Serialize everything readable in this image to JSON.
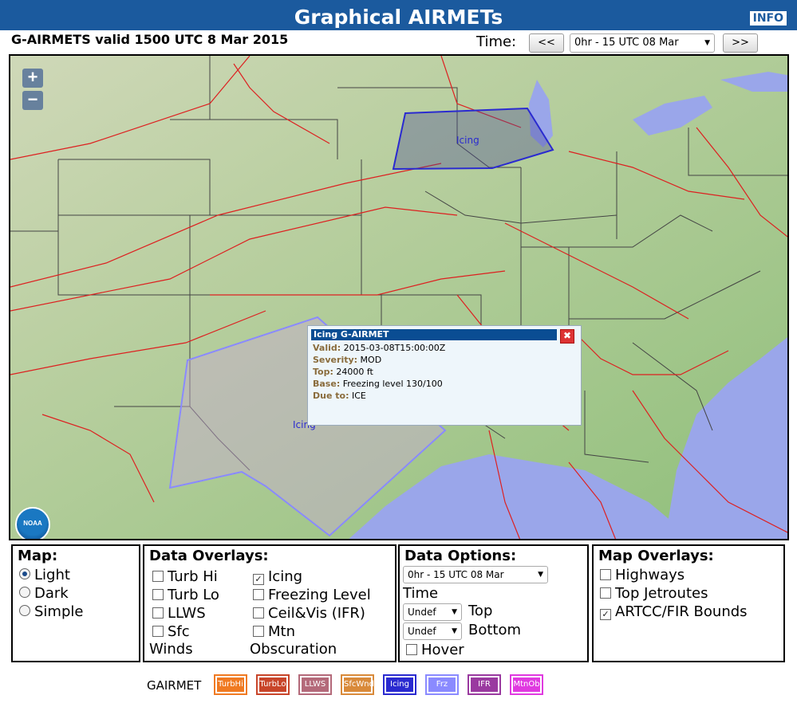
{
  "header": {
    "title": "Graphical AIRMETs",
    "info_label": "INFO"
  },
  "valid_text": "G-AIRMETS valid 1500 UTC 8 Mar 2015",
  "time": {
    "label": "Time:",
    "prev_label": "<<",
    "next_label": ">>",
    "selected": "0hr - 15 UTC 08 Mar"
  },
  "map": {
    "zoom_in": "+",
    "zoom_out": "−",
    "noaa_logo": "NOAA",
    "areas": [
      {
        "label": "Icing",
        "color": "#2a2ad0"
      },
      {
        "label": "Icing",
        "color": "#8a8aff"
      }
    ]
  },
  "popup": {
    "title": "Icing G-AIRMET",
    "close_icon": "close-icon",
    "rows": [
      {
        "key": "Valid:",
        "value": "2015-03-08T15:00:00Z"
      },
      {
        "key": "Severity:",
        "value": "MOD"
      },
      {
        "key": "Top:",
        "value": "24000 ft"
      },
      {
        "key": "Base:",
        "value": "Freezing level 130/100"
      },
      {
        "key": "Due to:",
        "value": "ICE"
      }
    ]
  },
  "panels": {
    "map": {
      "title": "Map:",
      "options": [
        {
          "label": "Light",
          "selected": true
        },
        {
          "label": "Dark",
          "selected": false
        },
        {
          "label": "Simple",
          "selected": false
        }
      ]
    },
    "data_overlays": {
      "title": "Data Overlays:",
      "col1": [
        {
          "label": "Turb Hi",
          "checked": false
        },
        {
          "label": "Turb Lo",
          "checked": false
        },
        {
          "label": "LLWS",
          "checked": false
        },
        {
          "label": "Sfc",
          "checked": false
        }
      ],
      "col1_extra": "Winds",
      "col2": [
        {
          "label": "Icing",
          "checked": true
        },
        {
          "label": "Freezing Level",
          "checked": false
        },
        {
          "label": "Ceil&Vis (IFR)",
          "checked": false
        },
        {
          "label": "Mtn",
          "checked": false
        }
      ],
      "col2_extra": "Obscuration"
    },
    "data_options": {
      "title": "Data Options:",
      "time_select": "0hr - 15 UTC 08 Mar",
      "time_label": "Time",
      "top_select": "Undef",
      "top_label": "Top",
      "bottom_select": "Undef",
      "bottom_label": "Bottom",
      "hover_label": "Hover",
      "hover_checked": false
    },
    "map_overlays": {
      "title": "Map Overlays:",
      "options": [
        {
          "label": "Highways",
          "checked": false
        },
        {
          "label": "Top Jetroutes",
          "checked": false
        },
        {
          "label": "ARTCC/FIR Bounds",
          "checked": true
        }
      ]
    }
  },
  "legend": {
    "label": "GAIRMET",
    "items": [
      {
        "text": "TurbHi",
        "color": "#f07a22"
      },
      {
        "text": "TurbLo",
        "color": "#c8452a"
      },
      {
        "text": "LLWS",
        "color": "#b46a7a"
      },
      {
        "text": "SfcWnd",
        "color": "#d98a3a"
      },
      {
        "text": "Icing",
        "color": "#2a2ad0"
      },
      {
        "text": "Frz",
        "color": "#8a8aff"
      },
      {
        "text": "IFR",
        "color": "#9a3aa0"
      },
      {
        "text": "MtnOb",
        "color": "#e03ae0"
      }
    ]
  }
}
